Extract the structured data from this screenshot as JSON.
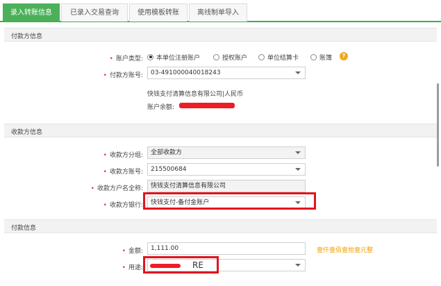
{
  "tabs": [
    {
      "label": "录入转账信息",
      "active": true
    },
    {
      "label": "已录入交易查询",
      "active": false
    },
    {
      "label": "使用模板转账",
      "active": false
    },
    {
      "label": "离线制单导入",
      "active": false
    }
  ],
  "payer_section": {
    "title": "付款方信息",
    "account_type_label": "账户类型:",
    "account_type_options": [
      {
        "label": "本单位注册账户",
        "selected": true
      },
      {
        "label": "授权账户",
        "selected": false
      },
      {
        "label": "单位结算卡",
        "selected": false
      },
      {
        "label": "账簿",
        "selected": false
      }
    ],
    "help_icon": "?",
    "account_no_label": "付款方账号:",
    "account_no_value": "03-491000040018243",
    "account_name_currency": "快钱支付清算信息有限公司|人民币",
    "balance_label": "账户余额:"
  },
  "payee_section": {
    "title": "收款方信息",
    "group_label": "收款方分组:",
    "group_value": "全部收款方",
    "account_label": "收款方账号:",
    "account_value": "215500684",
    "name_label": "收款方户名全称:",
    "name_value": "快钱支付清算信息有限公司",
    "bank_label": "收款方银行:",
    "bank_value": "快钱支付-备付金账户"
  },
  "payment_section": {
    "title": "付款信息",
    "amount_label": "金额:",
    "amount_value": "1,111.00",
    "amount_words": "壹仟壹佰壹拾壹元整",
    "purpose_label": "用途:",
    "purpose_value": "RE"
  },
  "colors": {
    "accent_green": "#4cb05a",
    "highlight_red": "#e0141e",
    "hint_orange": "#f0a000"
  },
  "required_mark": "•"
}
